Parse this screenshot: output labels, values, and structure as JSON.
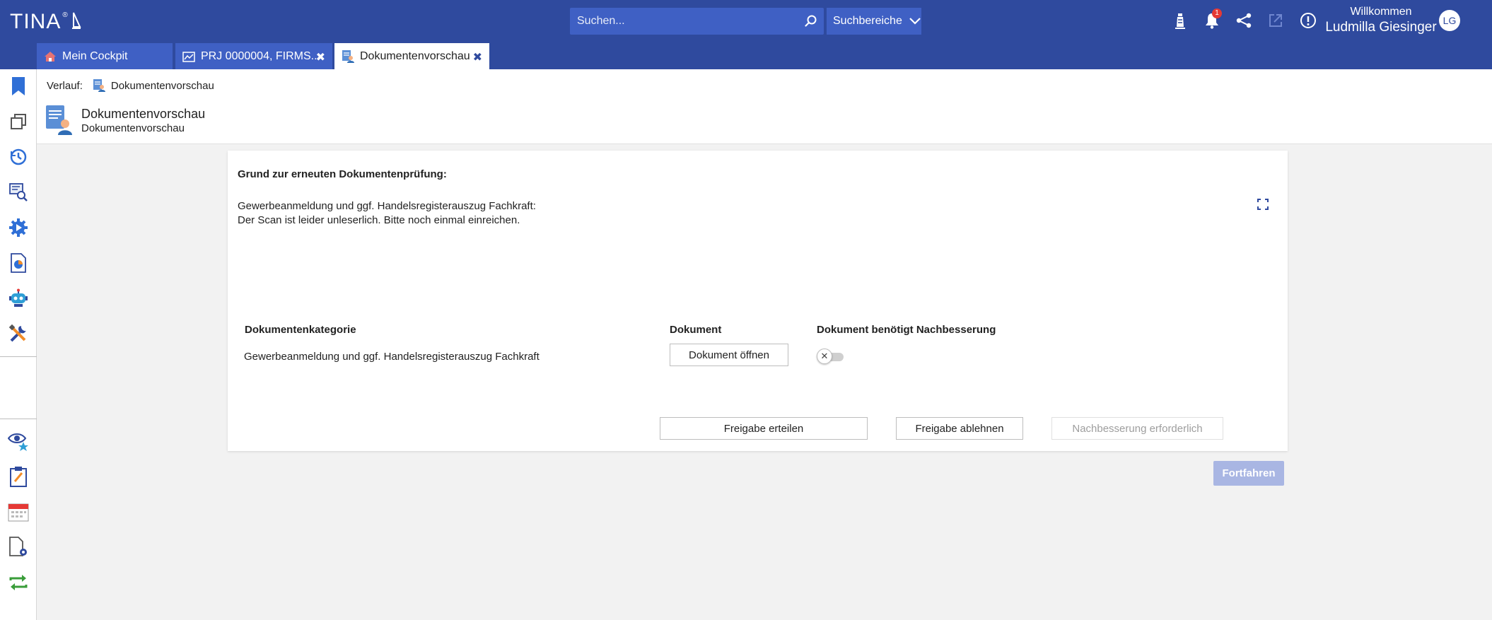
{
  "app": {
    "logo_text": "TINA",
    "logo_mark": "®"
  },
  "search": {
    "placeholder": "Suchen...",
    "scope_label": "Suchbereiche"
  },
  "notifications": {
    "count": "1"
  },
  "user": {
    "welcome": "Willkommen",
    "name": "Ludmilla Giesinger",
    "initials": "LG"
  },
  "tabs": [
    {
      "label": "Mein Cockpit",
      "icon": "home-icon"
    },
    {
      "label": "PRJ 0000004, FIRMS...",
      "icon": "project-icon"
    },
    {
      "label": "Dokumentenvorschau",
      "icon": "document-preview-icon"
    }
  ],
  "header": {
    "history_label": "Verlauf:",
    "history_item": "Dokumentenvorschau",
    "title": "Dokumentenvorschau",
    "subtitle": "Dokumentenvorschau"
  },
  "card": {
    "reason_title": "Grund zur erneuten Dokumentenprüfung:",
    "reason_line1": "Gewerbeanmeldung und ggf. Handelsregisterauszug Fachkraft:",
    "reason_line2": "Der Scan ist leider unleserlich. Bitte noch einmal einreichen.",
    "table": {
      "headers": [
        "Dokumentenkategorie",
        "Dokument",
        "Dokument benötigt Nachbesserung"
      ],
      "rows": [
        {
          "category": "Gewerbeanmeldung und ggf. Handelsregisterauszug Fachkraft",
          "document_button": "Dokument öffnen",
          "needs_revision": false
        }
      ]
    },
    "actions": {
      "approve": "Freigabe erteilen",
      "reject": "Freigabe ablehnen",
      "revision": "Nachbesserung erforderlich"
    }
  },
  "continue_label": "Fortfahren",
  "colors": {
    "primary": "#2f4a9e",
    "tab_inactive": "#3f60c4",
    "continue_disabled": "#a9b6e3"
  }
}
